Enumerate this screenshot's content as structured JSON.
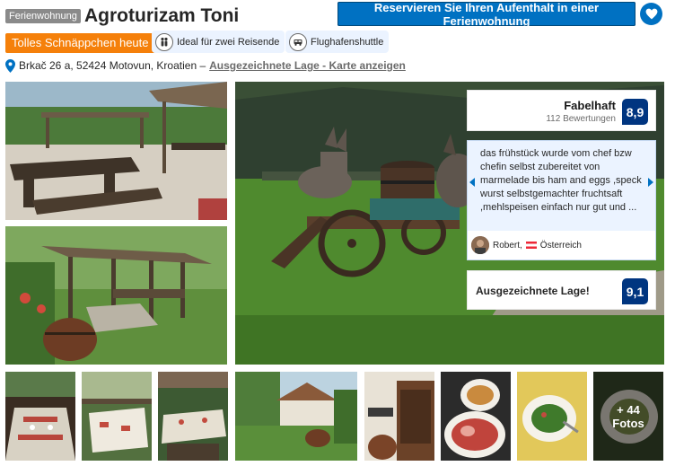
{
  "header": {
    "type_badge": "Ferienwohnung",
    "hotel_name": "Agroturizam Toni",
    "reserve_label": "Reservieren Sie Ihren Aufenthalt in einer Ferienwohnung",
    "deal_badge": "Tolles Schnäppchen heute",
    "pills": [
      {
        "icon": "couple-icon",
        "label": "Ideal für zwei Reisende"
      },
      {
        "icon": "shuttle-icon",
        "label": "Flughafenshuttle"
      }
    ],
    "address": "Brkač 26 a, 52424 Motovun, Kroatien –",
    "address_link": "Ausgezeichnete Lage - Karte anzeigen"
  },
  "score": {
    "word": "Fabelhaft",
    "count": "112 Bewertungen",
    "value": "8,9"
  },
  "review": {
    "text": "das frühstück wurde vom chef bzw chefin selbst zubereitet von marmelade bis ham and eggs ,speck wurst selbstgemachter fruchtsaft ,mehlspeisen einfach nur gut und ...",
    "author": "Robert,",
    "country": "Österreich"
  },
  "location": {
    "label": "Ausgezeichnete Lage!",
    "value": "9,1"
  },
  "gallery": {
    "more_count": "+ 44",
    "more_label": "Fotos"
  },
  "colors": {
    "primary_blue": "#0071c2",
    "dark_blue": "#003580",
    "deal_orange": "#f5800a",
    "light_blue_bg": "#ebf3ff"
  }
}
